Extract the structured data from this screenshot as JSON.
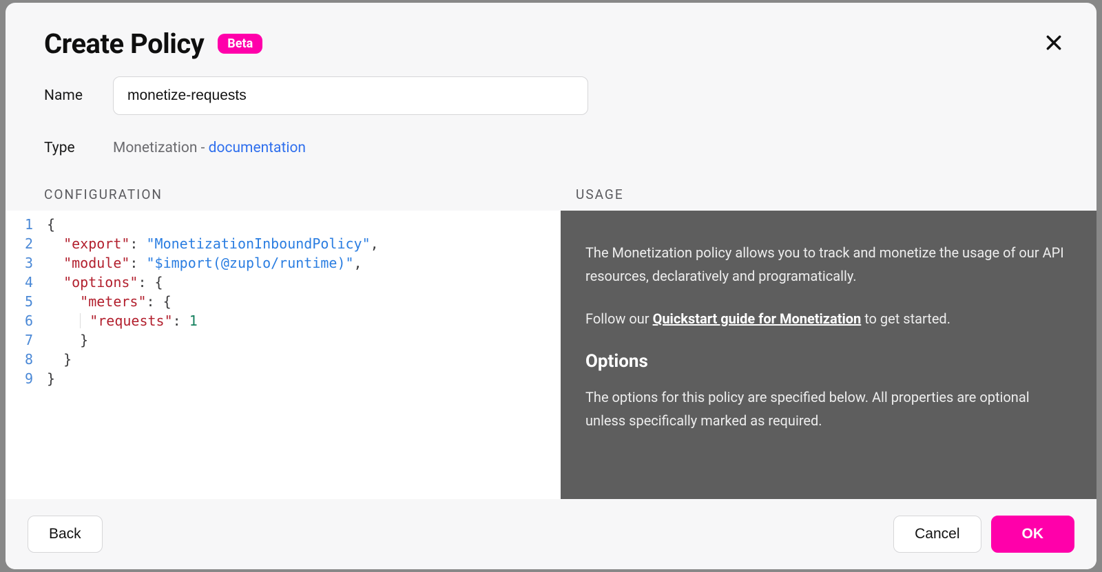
{
  "modal": {
    "title": "Create Policy",
    "betaLabel": "Beta",
    "closeAria": "Close"
  },
  "fields": {
    "nameLabel": "Name",
    "nameValue": "monetize-requests",
    "typeLabel": "Type",
    "typeText": "Monetization - ",
    "typeLinkLabel": "documentation"
  },
  "sections": {
    "configuration": "CONFIGURATION",
    "usage": "USAGE"
  },
  "code": {
    "lineNumbers": [
      "1",
      "2",
      "3",
      "4",
      "5",
      "6",
      "7",
      "8",
      "9"
    ],
    "keys": {
      "export": "\"export\"",
      "module": "\"module\"",
      "options": "\"options\"",
      "meters": "\"meters\"",
      "requests": "\"requests\""
    },
    "values": {
      "exportVal": "\"MonetizationInboundPolicy\"",
      "moduleVal": "\"$import(@zuplo/runtime)\"",
      "requestsVal": "1"
    }
  },
  "usage": {
    "p1": "The Monetization policy allows you to track and monetize the usage of our API resources, declaratively and programatically.",
    "p2a": "Follow our ",
    "quickLink": "Quickstart guide for Monetization",
    "p2b": " to get started.",
    "optionsHeading": "Options",
    "optionsBody": "The options for this policy are specified below. All properties are optional unless specifically marked as required."
  },
  "footer": {
    "back": "Back",
    "cancel": "Cancel",
    "ok": "OK"
  }
}
